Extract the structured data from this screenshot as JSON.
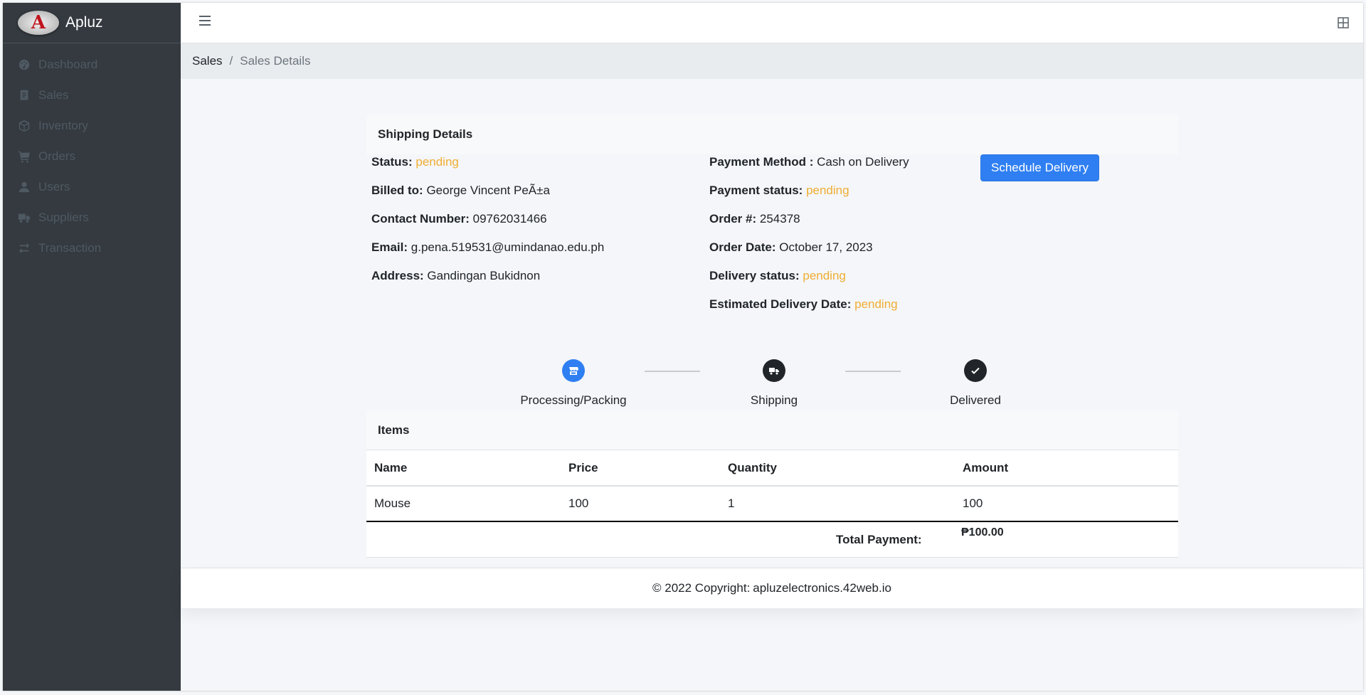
{
  "brand": {
    "logo_letter": "A",
    "name": "Apluz"
  },
  "sidebar": {
    "items": [
      {
        "label": "Dashboard",
        "icon": "tachometer-icon"
      },
      {
        "label": "Sales",
        "icon": "receipt-icon"
      },
      {
        "label": "Inventory",
        "icon": "box-icon"
      },
      {
        "label": "Orders",
        "icon": "cart-icon"
      },
      {
        "label": "Users",
        "icon": "user-icon"
      },
      {
        "label": "Suppliers",
        "icon": "truck-icon"
      },
      {
        "label": "Transaction",
        "icon": "exchange-icon"
      }
    ]
  },
  "breadcrumb": {
    "parent": "Sales",
    "separator": "/",
    "current": "Sales Details"
  },
  "shipping": {
    "header": "Shipping Details",
    "status_label": "Status:",
    "status_value": "pending",
    "billed_label": "Billed to:",
    "billed_value": "George Vincent PeÃ±a",
    "contact_label": "Contact Number:",
    "contact_value": "09762031466",
    "email_label": "Email:",
    "email_value": "g.pena.519531@umindanao.edu.ph",
    "address_label": "Address:",
    "address_value": "Gandingan Bukidnon",
    "payment_method_label": "Payment Method :",
    "payment_method_value": "Cash on Delivery",
    "payment_status_label": "Payment status:",
    "payment_status_value": "pending",
    "order_no_label": "Order #:",
    "order_no_value": "254378",
    "order_date_label": "Order Date:",
    "order_date_value": "October 17, 2023",
    "delivery_status_label": "Delivery status:",
    "delivery_status_value": "pending",
    "eta_label": "Estimated Delivery Date:",
    "eta_value": "pending",
    "schedule_button": "Schedule Delivery"
  },
  "tracker": {
    "steps": [
      {
        "label": "Processing/Packing",
        "icon": "store-icon",
        "color": "#2f7ff2"
      },
      {
        "label": "Shipping",
        "icon": "truck-icon",
        "color": "#212529"
      },
      {
        "label": "Delivered",
        "icon": "check-icon",
        "color": "#212529"
      }
    ]
  },
  "items": {
    "header": "Items",
    "columns": [
      "Name",
      "Price",
      "Quantity",
      "Amount"
    ],
    "rows": [
      [
        "Mouse",
        "100",
        "1",
        "100"
      ]
    ],
    "total_label": "Total Payment:",
    "total_value": "₱100.00"
  },
  "footer": {
    "text": "© 2022 Copyright:",
    "link": "apluzelectronics.42web.io"
  },
  "colors": {
    "sidebar_bg": "#343a40",
    "accent": "#2f7ff2",
    "pending": "#f0ad33"
  }
}
